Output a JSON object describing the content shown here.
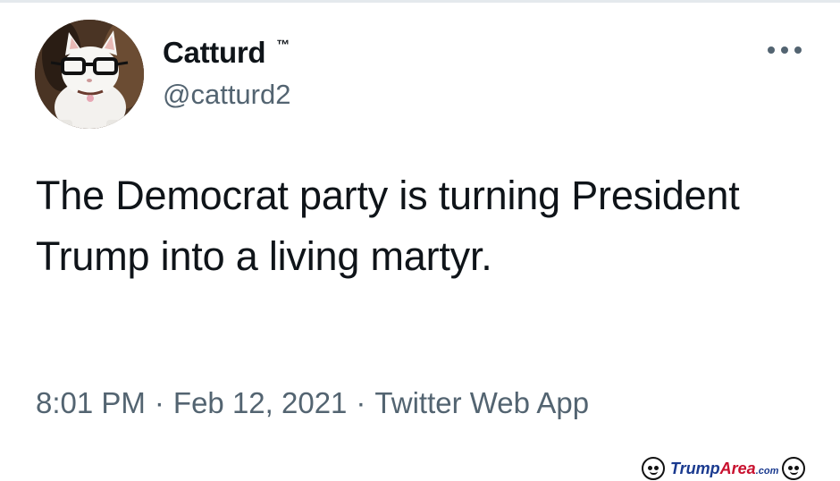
{
  "author": {
    "display_name": "Catturd",
    "trademark": "™",
    "handle": "@catturd2",
    "avatar_icon": "cat-with-glasses-avatar"
  },
  "menu": {
    "icon": "more-options-icon"
  },
  "tweet": {
    "text": "The Democrat party is turning President Trump into a living martyr."
  },
  "meta": {
    "time": "8:01 PM",
    "separator": "·",
    "date": "Feb 12, 2021",
    "source": "Twitter Web App"
  },
  "watermark": {
    "trump": "Trump",
    "area": "Area",
    "domain": ".com",
    "icon": "cartoon-face-icon"
  },
  "colors": {
    "text": "#0f1419",
    "secondary": "#536471",
    "watermark_blue": "#1a3a8f",
    "watermark_red": "#c8102e"
  }
}
